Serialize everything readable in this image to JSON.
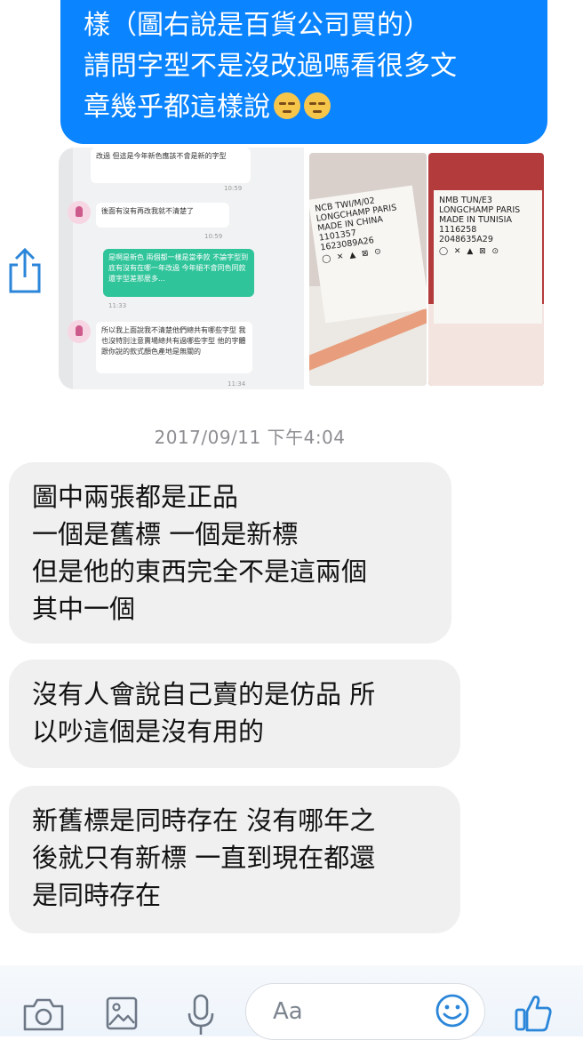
{
  "outgoing_message": {
    "lines": [
      "樣（圖右說是百貨公司買的）",
      "請問字型不是沒改過嗎看很多文",
      "章幾乎都這樣說"
    ],
    "emojis": [
      "pensive-face-emoji",
      "pensive-face-emoji"
    ],
    "color": "#0a84ff"
  },
  "shared_image": {
    "chat_screenshot": {
      "messages": [
        "改過 但這是今年新色應該不會是新的字型",
        "後面有沒有再改我就不清楚了",
        "是啊是新色 兩個都一樣是當季款 不論字型到底有沒有在哪一年改過 今年絕不會同色同款還字型差那麼多...",
        "所以我上面說我不清楚他們總共有哪些字型 我也沒特別注意賣場總共有過哪些字型 他的字體跟你說的款式顏色產地是無關的"
      ],
      "times": [
        "10:59",
        "10:59",
        "11:33",
        "11:34"
      ]
    },
    "tag_left": {
      "lines": [
        "NCB    TWI/M/02",
        "LONGCHAMP PARIS",
        "MADE IN CHINA",
        "1101357",
        "1623089A26"
      ]
    },
    "tag_right": {
      "lines": [
        "NMB    TUN/E3",
        "LONGCHAMP PARIS",
        "MADE IN TUNISIA",
        "1116258",
        "2048635A29"
      ]
    }
  },
  "timestamp": "2017/09/11 下午4:04",
  "incoming_messages": [
    {
      "lines": [
        "圖中兩張都是正品",
        "一個是舊標 一個是新標",
        "但是他的東西完全不是這兩個",
        "其中一個"
      ]
    },
    {
      "lines": [
        "沒有人會說自己賣的是仿品 所",
        "以吵這個是沒有用的"
      ]
    },
    {
      "lines": [
        "新舊標是同時存在 沒有哪年之",
        "後就只有新標 一直到現在都還",
        "是同時存在"
      ]
    }
  ],
  "composer": {
    "placeholder": "Aa",
    "icons": [
      "camera-icon",
      "photo-icon",
      "microphone-icon",
      "emoji-icon",
      "thumbs-up-icon"
    ]
  },
  "colors": {
    "accent": "#0a84ff",
    "incoming_bubble": "#f1f0f0",
    "timestamp": "#8e8e93"
  }
}
